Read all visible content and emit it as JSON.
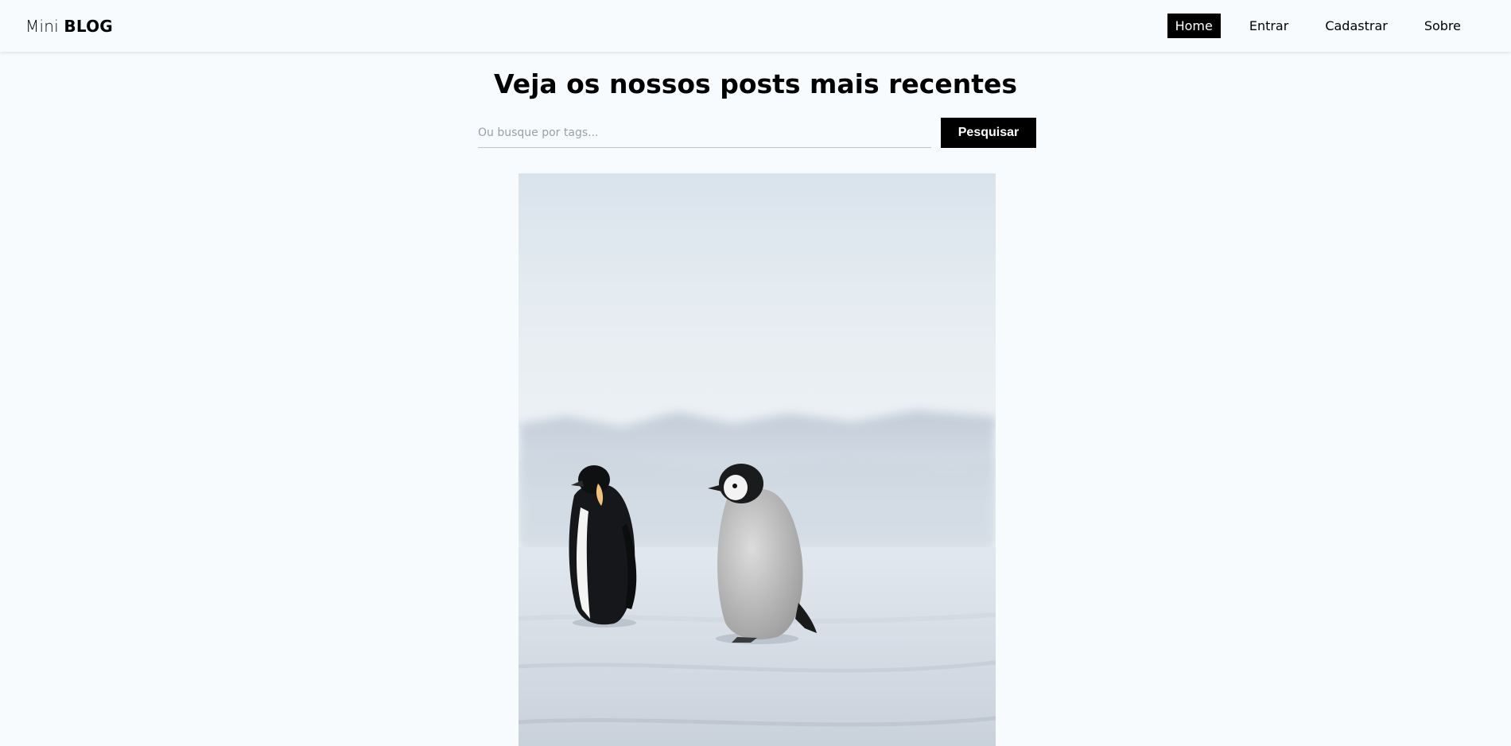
{
  "nav": {
    "brand_light": "Mini",
    "brand_bold": "BLOG",
    "links": [
      {
        "label": "Home",
        "active": true
      },
      {
        "label": "Entrar",
        "active": false
      },
      {
        "label": "Cadastrar",
        "active": false
      },
      {
        "label": "Sobre",
        "active": false
      }
    ]
  },
  "main": {
    "title": "Veja os nossos posts mais recentes",
    "search_placeholder": "Ou busque por tags...",
    "search_button": "Pesquisar"
  },
  "post": {
    "image_subject": "two penguins on snow"
  },
  "colors": {
    "background": "#f7fbfe",
    "accent": "#000000"
  }
}
